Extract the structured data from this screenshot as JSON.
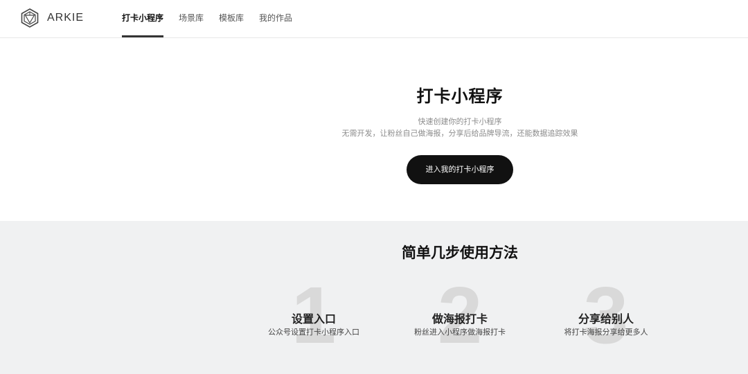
{
  "header": {
    "logo_text": "ARKIE",
    "nav": [
      {
        "label": "打卡小程序",
        "active": true
      },
      {
        "label": "场景库",
        "active": false
      },
      {
        "label": "模板库",
        "active": false
      },
      {
        "label": "我的作品",
        "active": false
      }
    ]
  },
  "hero": {
    "title": "打卡小程序",
    "subtitle_line1": "快速创建你的打卡小程序",
    "subtitle_line2": "无需开发，让粉丝自己做海报，分享后给品牌导流，还能数据追踪效果",
    "cta_label": "进入我的打卡小程序"
  },
  "steps": {
    "title": "简单几步使用方法",
    "items": [
      {
        "number": "1",
        "title": "设置入口",
        "desc": "公众号设置打卡小程序入口"
      },
      {
        "number": "2",
        "title": "做海报打卡",
        "desc": "粉丝进入小程序做海报打卡"
      },
      {
        "number": "3",
        "title": "分享给别人",
        "desc": "将打卡海报分享给更多人"
      }
    ]
  },
  "colors": {
    "primary_button": "#111111",
    "steps_background": "#f0f1f2",
    "step_number": "#d9d9d9"
  }
}
